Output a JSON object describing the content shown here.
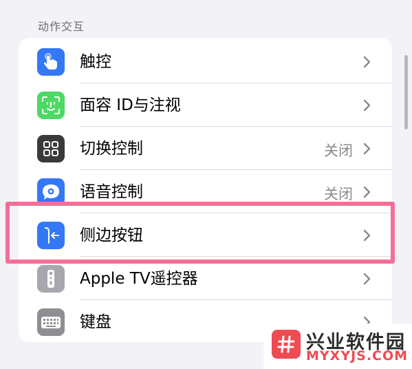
{
  "section": {
    "title": "动作交互"
  },
  "items": [
    {
      "label": "触控",
      "value": "",
      "icon": "hand-point-icon",
      "color": "#3478f6"
    },
    {
      "label": "面容 ID与注视",
      "value": "",
      "icon": "face-id-icon",
      "color": "#4cd964"
    },
    {
      "label": "切换控制",
      "value": "关闭",
      "icon": "switch-control-grid-icon",
      "color": "#3a3a3c"
    },
    {
      "label": "语音控制",
      "value": "关闭",
      "icon": "voice-control-icon",
      "color": "#3478f6"
    },
    {
      "label": "侧边按钮",
      "value": "",
      "icon": "side-button-icon",
      "color": "#3478f6"
    },
    {
      "label": "Apple TV遥控器",
      "value": "",
      "icon": "tv-remote-icon",
      "color": "#a7a7ad"
    },
    {
      "label": "键盘",
      "value": "",
      "icon": "keyboard-icon",
      "color": "#8e8e93"
    }
  ],
  "highlight_color": "#f36f97",
  "watermark": {
    "name": "兴业软件园",
    "url": "MYXYJS.COM",
    "logo_icon": "hash-icon",
    "color": "#ef4b52"
  }
}
